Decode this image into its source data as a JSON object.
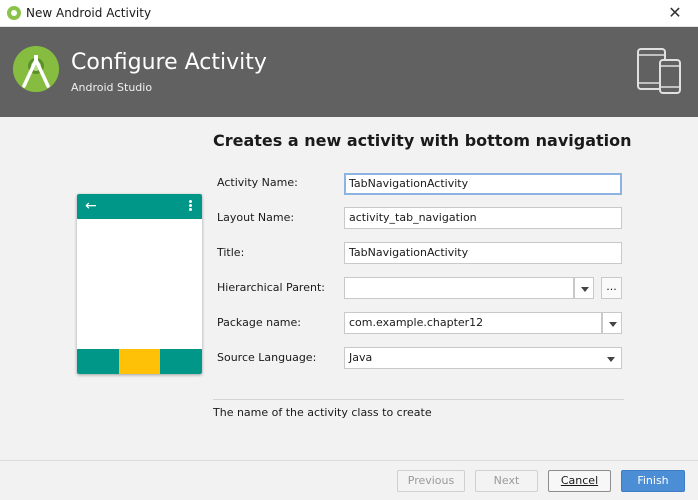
{
  "window": {
    "title": "New Android Activity",
    "close_glyph": "✕"
  },
  "header": {
    "title": "Configure Activity",
    "subtitle": "Android Studio",
    "background": "#616161",
    "logo_color": "#86bd40"
  },
  "main": {
    "heading": "Creates a new activity with bottom navigation",
    "hint": "The name of the activity class to create"
  },
  "preview": {
    "appbar_color": "#009688",
    "accent_color": "#ffc107",
    "back_glyph": "←"
  },
  "form": {
    "activity_name": {
      "label": "Activity Name:",
      "value": "TabNavigationActivity"
    },
    "layout_name": {
      "label": "Layout Name:",
      "value": "activity_tab_navigation"
    },
    "title": {
      "label": "Title:",
      "value": "TabNavigationActivity"
    },
    "hierarchical_parent": {
      "label": "Hierarchical Parent:",
      "value": "",
      "browse_label": "..."
    },
    "package_name": {
      "label": "Package name:",
      "value": "com.example.chapter12"
    },
    "source_language": {
      "label": "Source Language:",
      "value": "Java"
    }
  },
  "footer": {
    "previous": "Previous",
    "next": "Next",
    "cancel": "Cancel",
    "finish": "Finish"
  }
}
